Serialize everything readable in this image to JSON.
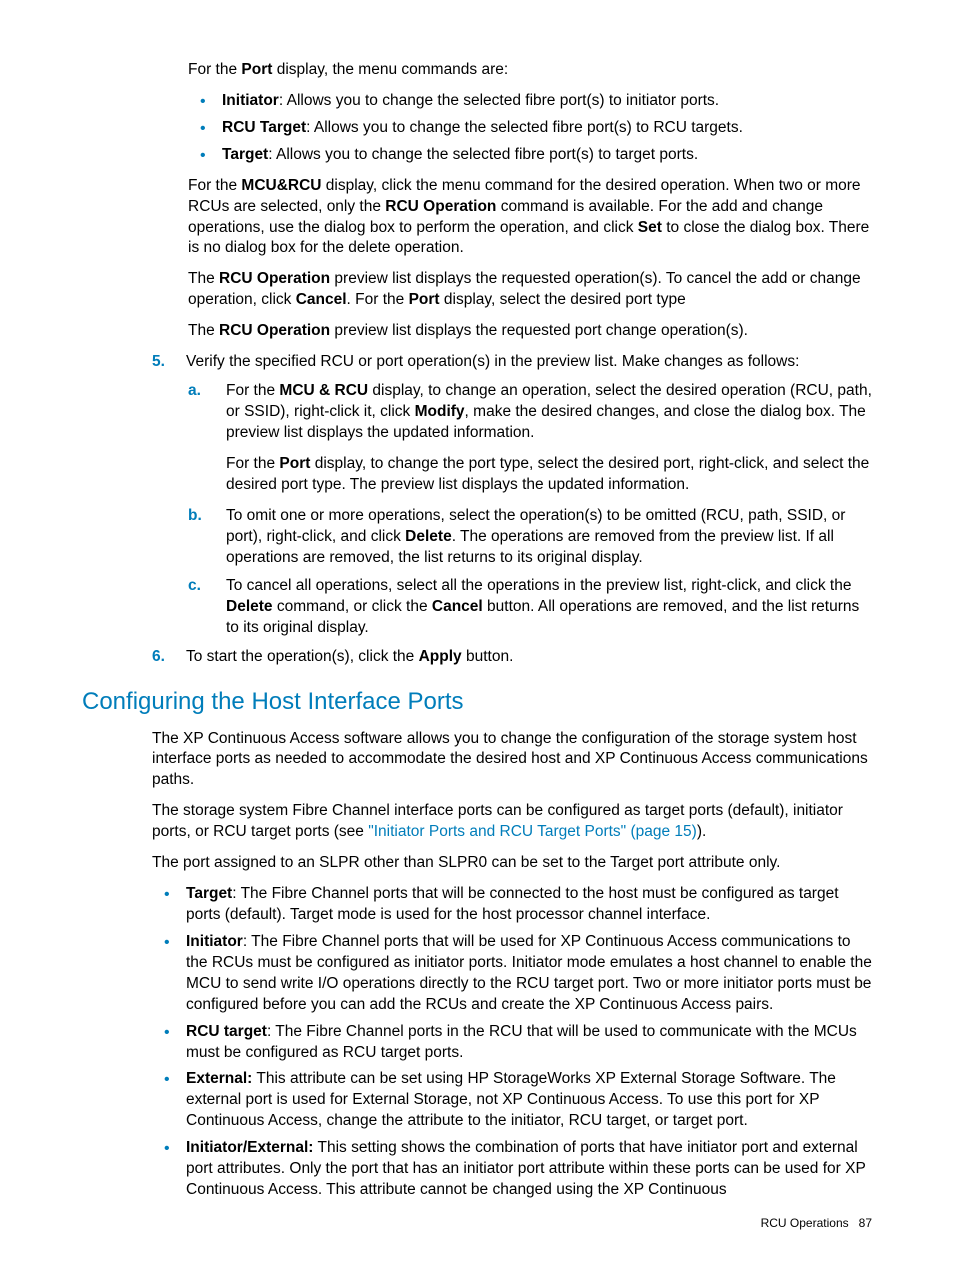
{
  "intro": {
    "port_lead_pre": "For the ",
    "port_bold": "Port",
    "port_lead_post": " display, the menu commands are:",
    "port_items": [
      {
        "b": "Initiator",
        "t": ": Allows you to change the selected fibre port(s) to initiator ports."
      },
      {
        "b": "RCU Target",
        "t": ": Allows you to change the selected fibre port(s) to RCU targets."
      },
      {
        "b": "Target",
        "t": ": Allows you to change the selected fibre port(s) to target ports."
      }
    ],
    "mcu_p1_a": "For the ",
    "mcu_b1": "MCU&RCU",
    "mcu_p1_b": " display, click the menu command for the desired operation. When two or more RCUs are selected, only the ",
    "mcu_b2": "RCU Operation",
    "mcu_p1_c": " command is available. For the add and change operations, use the dialog box to perform the operation, and click ",
    "mcu_b3": "Set",
    "mcu_p1_d": " to close the dialog box. There is no dialog box for the delete operation.",
    "mcu_p2_a": "The ",
    "mcu_p2_b1": "RCU Operation",
    "mcu_p2_b": " preview list displays the requested operation(s). To cancel the add or change operation, click ",
    "mcu_p2_b2": "Cancel",
    "mcu_p2_c": ". For the ",
    "mcu_p2_b3": "Port",
    "mcu_p2_d": " display, select the desired port type",
    "mcu_p3_a": "The ",
    "mcu_p3_b1": "RCU Operation",
    "mcu_p3_b": " preview list displays the requested port change operation(s)."
  },
  "step5": {
    "marker": "5.",
    "text": "Verify the specified RCU or port operation(s) in the preview list. Make changes as follows:",
    "a": {
      "marker": "a.",
      "t1": "For the ",
      "b1": "MCU & RCU",
      "t2": " display, to change an operation, select the desired operation (RCU, path, or SSID), right-click it, click ",
      "b2": "Modify",
      "t3": ", make the desired changes, and close the dialog box. The preview list displays the updated information.",
      "p2_t1": "For the ",
      "p2_b1": "Port",
      "p2_t2": " display, to change the port type, select the desired port, right-click, and select the desired port type. The preview list displays the updated information."
    },
    "b": {
      "marker": "b.",
      "t1": "To omit one or more operations, select the operation(s) to be omitted (RCU, path, SSID, or port), right-click, and click ",
      "b1": "Delete",
      "t2": ". The operations are removed from the preview list. If all operations are removed, the list returns to its original display."
    },
    "c": {
      "marker": "c.",
      "t1": "To cancel all operations, select all the operations in the preview list, right-click, and click the ",
      "b1": "Delete",
      "t2": " command, or click the ",
      "b2": "Cancel",
      "t3": " button. All operations are removed, and the list returns to its original display."
    }
  },
  "step6": {
    "marker": "6.",
    "t1": "To start the operation(s), click the ",
    "b1": "Apply",
    "t2": " button."
  },
  "section": {
    "title": "Configuring the Host Interface Ports",
    "p1": "The XP Continuous Access software allows you to change the configuration of the storage system host interface ports as needed to accommodate the desired host and XP Continuous Access communications paths.",
    "p2_a": "The storage system Fibre Channel interface ports can be configured as target ports (default), initiator ports, or RCU target ports (see ",
    "p2_link": "\"Initiator Ports and RCU Target Ports\" (page 15)",
    "p2_b": ").",
    "p3": "The port assigned to an SLPR other than SLPR0 can be set to the Target port attribute only.",
    "items": [
      {
        "b": "Target",
        "t": ": The Fibre Channel ports that will be connected to the host must be configured as target ports (default). Target mode is used for the host processor channel interface."
      },
      {
        "b": "Initiator",
        "t": ": The Fibre Channel ports that will be used for XP Continuous Access communications to the RCUs must be configured as initiator ports. Initiator mode emulates a host channel to enable the MCU to send write I/O operations directly to the RCU target port. Two or more initiator ports must be configured before you can add the RCUs and create the XP Continuous Access pairs."
      },
      {
        "b": "RCU target",
        "t": ": The Fibre Channel ports in the RCU that will be used to communicate with the MCUs must be configured as RCU target ports."
      },
      {
        "b": "External:",
        "t": " This attribute can be set using HP StorageWorks XP External Storage Software. The external port is used for External Storage, not XP Continuous Access. To use this port for XP Continuous Access, change the attribute to the initiator, RCU target, or target port."
      },
      {
        "b": "Initiator/External:",
        "t": " This setting shows the combination of ports that have initiator port and external port attributes. Only the port that has an initiator port attribute within these ports can be used for XP Continuous Access. This attribute cannot be changed using the XP Continuous"
      }
    ]
  },
  "footer": {
    "left": "RCU Operations",
    "right": "87"
  }
}
